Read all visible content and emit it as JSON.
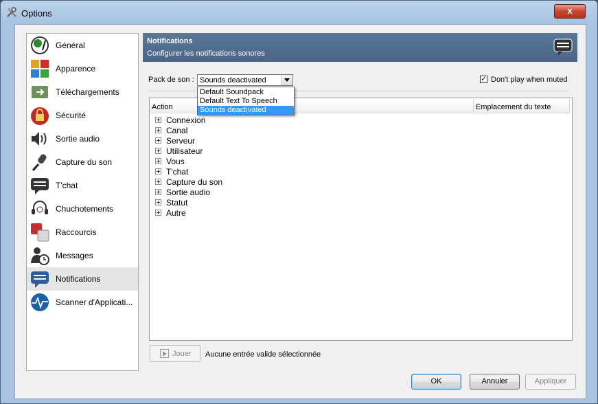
{
  "window": {
    "title": "Options",
    "close_symbol": "x"
  },
  "sidebar": {
    "items": [
      {
        "label": "Général",
        "icon": "general-icon"
      },
      {
        "label": "Apparence",
        "icon": "appearance-icon"
      },
      {
        "label": "Téléchargements",
        "icon": "downloads-icon"
      },
      {
        "label": "Sécurité",
        "icon": "security-lock-icon"
      },
      {
        "label": "Sortie audio",
        "icon": "speaker-icon"
      },
      {
        "label": "Capture du son",
        "icon": "microphone-icon"
      },
      {
        "label": "T'chat",
        "icon": "chat-icon"
      },
      {
        "label": "Chuchotements",
        "icon": "headset-icon"
      },
      {
        "label": "Raccourcis",
        "icon": "shortcuts-icon"
      },
      {
        "label": "Messages",
        "icon": "messages-icon"
      },
      {
        "label": "Notifications",
        "icon": "notifications-icon"
      },
      {
        "label": "Scanner d'Applicati...",
        "icon": "scanner-icon"
      }
    ],
    "active_index": 10
  },
  "header": {
    "title": "Notifications",
    "subtitle": "Configurer les notifications sonores"
  },
  "sound_pack": {
    "label": "Pack de son :",
    "selected": "Sounds deactivated",
    "options": [
      "Default Soundpack",
      "Default Text To Speech",
      "Sounds deactivated"
    ]
  },
  "mute": {
    "label": "Don't play when muted",
    "checked": true,
    "check_mark": "✓"
  },
  "tree": {
    "columns": [
      "Action",
      "Emplacement du texte"
    ],
    "rows": [
      "Connexion",
      "Canal",
      "Serveur",
      "Utilisateur",
      "Vous",
      "T'chat",
      "Capture du son",
      "Sortie audio",
      "Statut",
      "Autre"
    ]
  },
  "play": {
    "label": "Jouer"
  },
  "status": "Aucune entrée valide sélectionnée",
  "buttons": {
    "ok": "OK",
    "cancel": "Annuler",
    "apply": "Appliquer"
  }
}
